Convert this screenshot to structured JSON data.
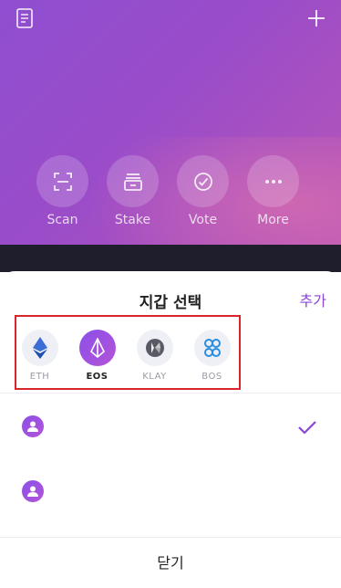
{
  "header": {
    "icons": [
      "document-icon",
      "plus-icon"
    ]
  },
  "actions": [
    {
      "label": "Scan",
      "icon": "scan-icon"
    },
    {
      "label": "Stake",
      "icon": "stake-icon"
    },
    {
      "label": "Vote",
      "icon": "vote-check-icon"
    },
    {
      "label": "More",
      "icon": "more-dots-icon"
    }
  ],
  "sheet": {
    "title": "지갑 선택",
    "add_label": "추가",
    "chains": [
      {
        "label": "ETH",
        "icon": "eth-icon",
        "selected": false
      },
      {
        "label": "EOS",
        "icon": "eos-icon",
        "selected": true
      },
      {
        "label": "KLAY",
        "icon": "klay-icon",
        "selected": false
      },
      {
        "label": "BOS",
        "icon": "bos-icon",
        "selected": false
      }
    ],
    "wallets": [
      {
        "icon": "user-avatar-icon",
        "selected": true
      },
      {
        "icon": "user-avatar-icon",
        "selected": false
      }
    ],
    "close_label": "닫기"
  },
  "colors": {
    "accent": "#8a45d6",
    "highlight_border": "#d9262d"
  }
}
